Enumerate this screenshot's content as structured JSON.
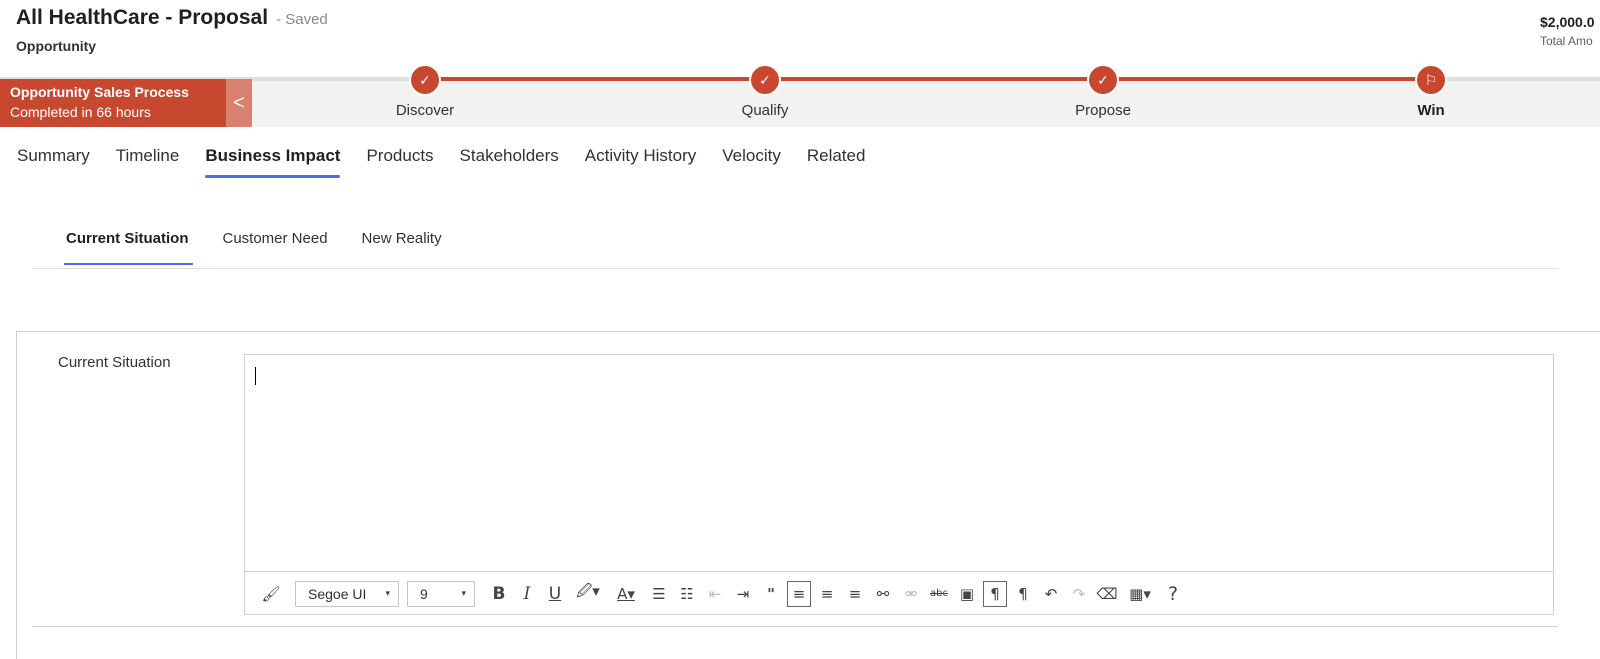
{
  "header": {
    "title": "All HealthCare - Proposal",
    "save_status": "- Saved",
    "entity": "Opportunity",
    "amount": "$2,000.0",
    "amount_label": "Total Amo"
  },
  "process": {
    "name": "Opportunity Sales Process",
    "completed": "Completed in 66 hours",
    "back_icon": "<",
    "stages": [
      {
        "label": "Discover",
        "icon": "✓"
      },
      {
        "label": "Qualify",
        "icon": "✓"
      },
      {
        "label": "Propose",
        "icon": "✓"
      },
      {
        "label": "Win",
        "icon": "⚐"
      }
    ]
  },
  "tabs": [
    "Summary",
    "Timeline",
    "Business Impact",
    "Products",
    "Stakeholders",
    "Activity History",
    "Velocity",
    "Related"
  ],
  "subtabs": [
    "Current Situation",
    "Customer Need",
    "New Reality"
  ],
  "field": {
    "label": "Current Situation"
  },
  "toolbar": {
    "font": "Segoe UI",
    "size": "9",
    "dropdown_arrow": "▾",
    "icons": {
      "format_painter": "🖌",
      "bold": "B",
      "italic": "I",
      "underline": "U",
      "highlight": "🖉▾",
      "font_color": "A▾",
      "bullets": "☰",
      "numbering": "☷",
      "outdent": "⇤",
      "indent": "⇥",
      "quote": "\"",
      "align_left": "≡",
      "align_center": "≡",
      "align_right": "≡",
      "link": "⚯",
      "unlink": "⚮",
      "strike": "abc",
      "image": "▣",
      "ltr": "¶",
      "rtl": "¶",
      "undo": "↶",
      "redo": "↷",
      "clear_format": "⌫",
      "table": "▦▾",
      "help": "?"
    }
  }
}
